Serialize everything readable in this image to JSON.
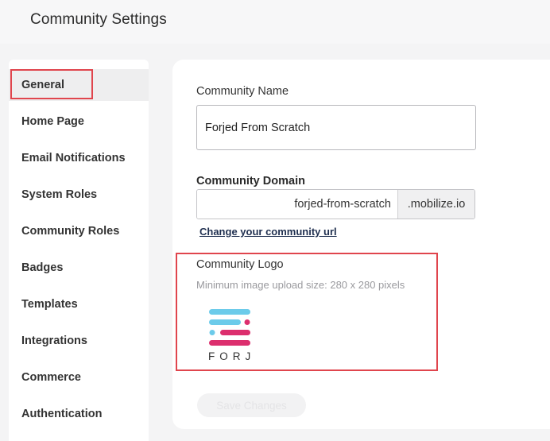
{
  "header": {
    "title": "Community Settings"
  },
  "sidebar": {
    "items": [
      {
        "label": "General",
        "active": true
      },
      {
        "label": "Home Page"
      },
      {
        "label": "Email Notifications"
      },
      {
        "label": "System Roles"
      },
      {
        "label": "Community Roles"
      },
      {
        "label": "Badges"
      },
      {
        "label": "Templates"
      },
      {
        "label": "Integrations"
      },
      {
        "label": "Commerce"
      },
      {
        "label": "Authentication"
      }
    ]
  },
  "form": {
    "community_name": {
      "label": "Community Name",
      "value": "Forjed From Scratch"
    },
    "community_domain": {
      "label": "Community Domain",
      "value": "forjed-from-scratch",
      "suffix": ".mobilize.io",
      "change_link": "Change your community url"
    },
    "community_logo": {
      "label": "Community Logo",
      "hint": "Minimum image upload size: 280 x 280 pixels",
      "logo_text": "FORJ",
      "logo_colors": {
        "blue": "#6ccbea",
        "pink": "#dc2f6e"
      }
    },
    "save_label": "Save Changes"
  },
  "colors": {
    "highlight": "#e0454d",
    "background": "#f4f4f5",
    "card": "#ffffff"
  }
}
